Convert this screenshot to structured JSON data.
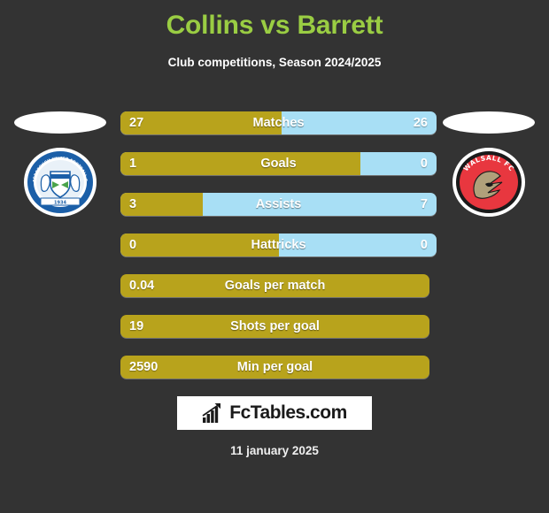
{
  "header": {
    "title": "Collins vs Barrett",
    "subtitle": "Club competitions, Season 2024/2025",
    "title_color": "#9acd43"
  },
  "teams": {
    "home": {
      "name": "Peterborough United Football Club",
      "badge_text_top": "PETERBOROUGH UNITED FOOTBALL CLUB",
      "badge_year": "1934",
      "color": "#b8a31c"
    },
    "away": {
      "name": "Walsall FC",
      "badge_text_top": "WALSALL FC",
      "color": "#a8dff5"
    }
  },
  "chart_data": {
    "type": "bar",
    "title": "Collins vs Barrett",
    "subtitle": "Club competitions, Season 2024/2025",
    "legend": [
      "Collins",
      "Barrett"
    ],
    "series": [
      {
        "name": "Collins",
        "color": "#b8a31c"
      },
      {
        "name": "Barrett",
        "color": "#a8dff5"
      }
    ],
    "categories": [
      "Matches",
      "Goals",
      "Assists",
      "Hattricks",
      "Goals per match",
      "Shots per goal",
      "Min per goal"
    ],
    "rows": [
      {
        "label": "Matches",
        "home": "27",
        "away": "26",
        "home_pct": 51,
        "dual": true
      },
      {
        "label": "Goals",
        "home": "1",
        "away": "0",
        "home_pct": 76,
        "dual": true
      },
      {
        "label": "Assists",
        "home": "3",
        "away": "7",
        "home_pct": 26,
        "dual": true
      },
      {
        "label": "Hattricks",
        "home": "0",
        "away": "0",
        "home_pct": 50,
        "dual": true
      },
      {
        "label": "Goals per match",
        "home": "0.04",
        "away": "",
        "home_pct": 100,
        "dual": false
      },
      {
        "label": "Shots per goal",
        "home": "19",
        "away": "",
        "home_pct": 100,
        "dual": false
      },
      {
        "label": "Min per goal",
        "home": "2590",
        "away": "",
        "home_pct": 100,
        "dual": false
      }
    ]
  },
  "footer": {
    "logo_text": "FcTables.com",
    "logo_icon": "bar-chart-arrow-icon",
    "date": "11 january 2025"
  }
}
